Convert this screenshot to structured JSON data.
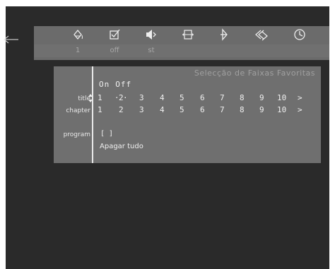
{
  "toolbar": {
    "icons": [
      "paint-bucket-icon",
      "checkbox-icon",
      "audio-speaker-icon",
      "subtitle-frame-icon",
      "angle-icon",
      "ab-repeat-icon",
      "timer-clock-icon"
    ],
    "values": [
      "1",
      "off",
      "st"
    ]
  },
  "panel": {
    "title": "Selecção de Faixas Favoritas",
    "on_label": "On",
    "off_label": "Off",
    "title_row_label": "title",
    "chapter_row_label": "chapter",
    "program_row_label": "program",
    "title_numbers": [
      "1",
      "2",
      "3",
      "4",
      "5",
      "6",
      "7",
      "8",
      "9",
      "10"
    ],
    "chapter_numbers": [
      "1",
      "2",
      "3",
      "4",
      "5",
      "6",
      "7",
      "8",
      "9",
      "10"
    ],
    "next_glyph": ">",
    "program_value": "[ ]",
    "clear_all": "Apagar tudo",
    "selected_title": "2"
  },
  "colors": {
    "screen": "#2a2a2a",
    "toolbar": "#6b6b6b",
    "panel": "#6f6f6f",
    "text": "#f0f0f0",
    "dim_text": "#a0a0a0"
  }
}
